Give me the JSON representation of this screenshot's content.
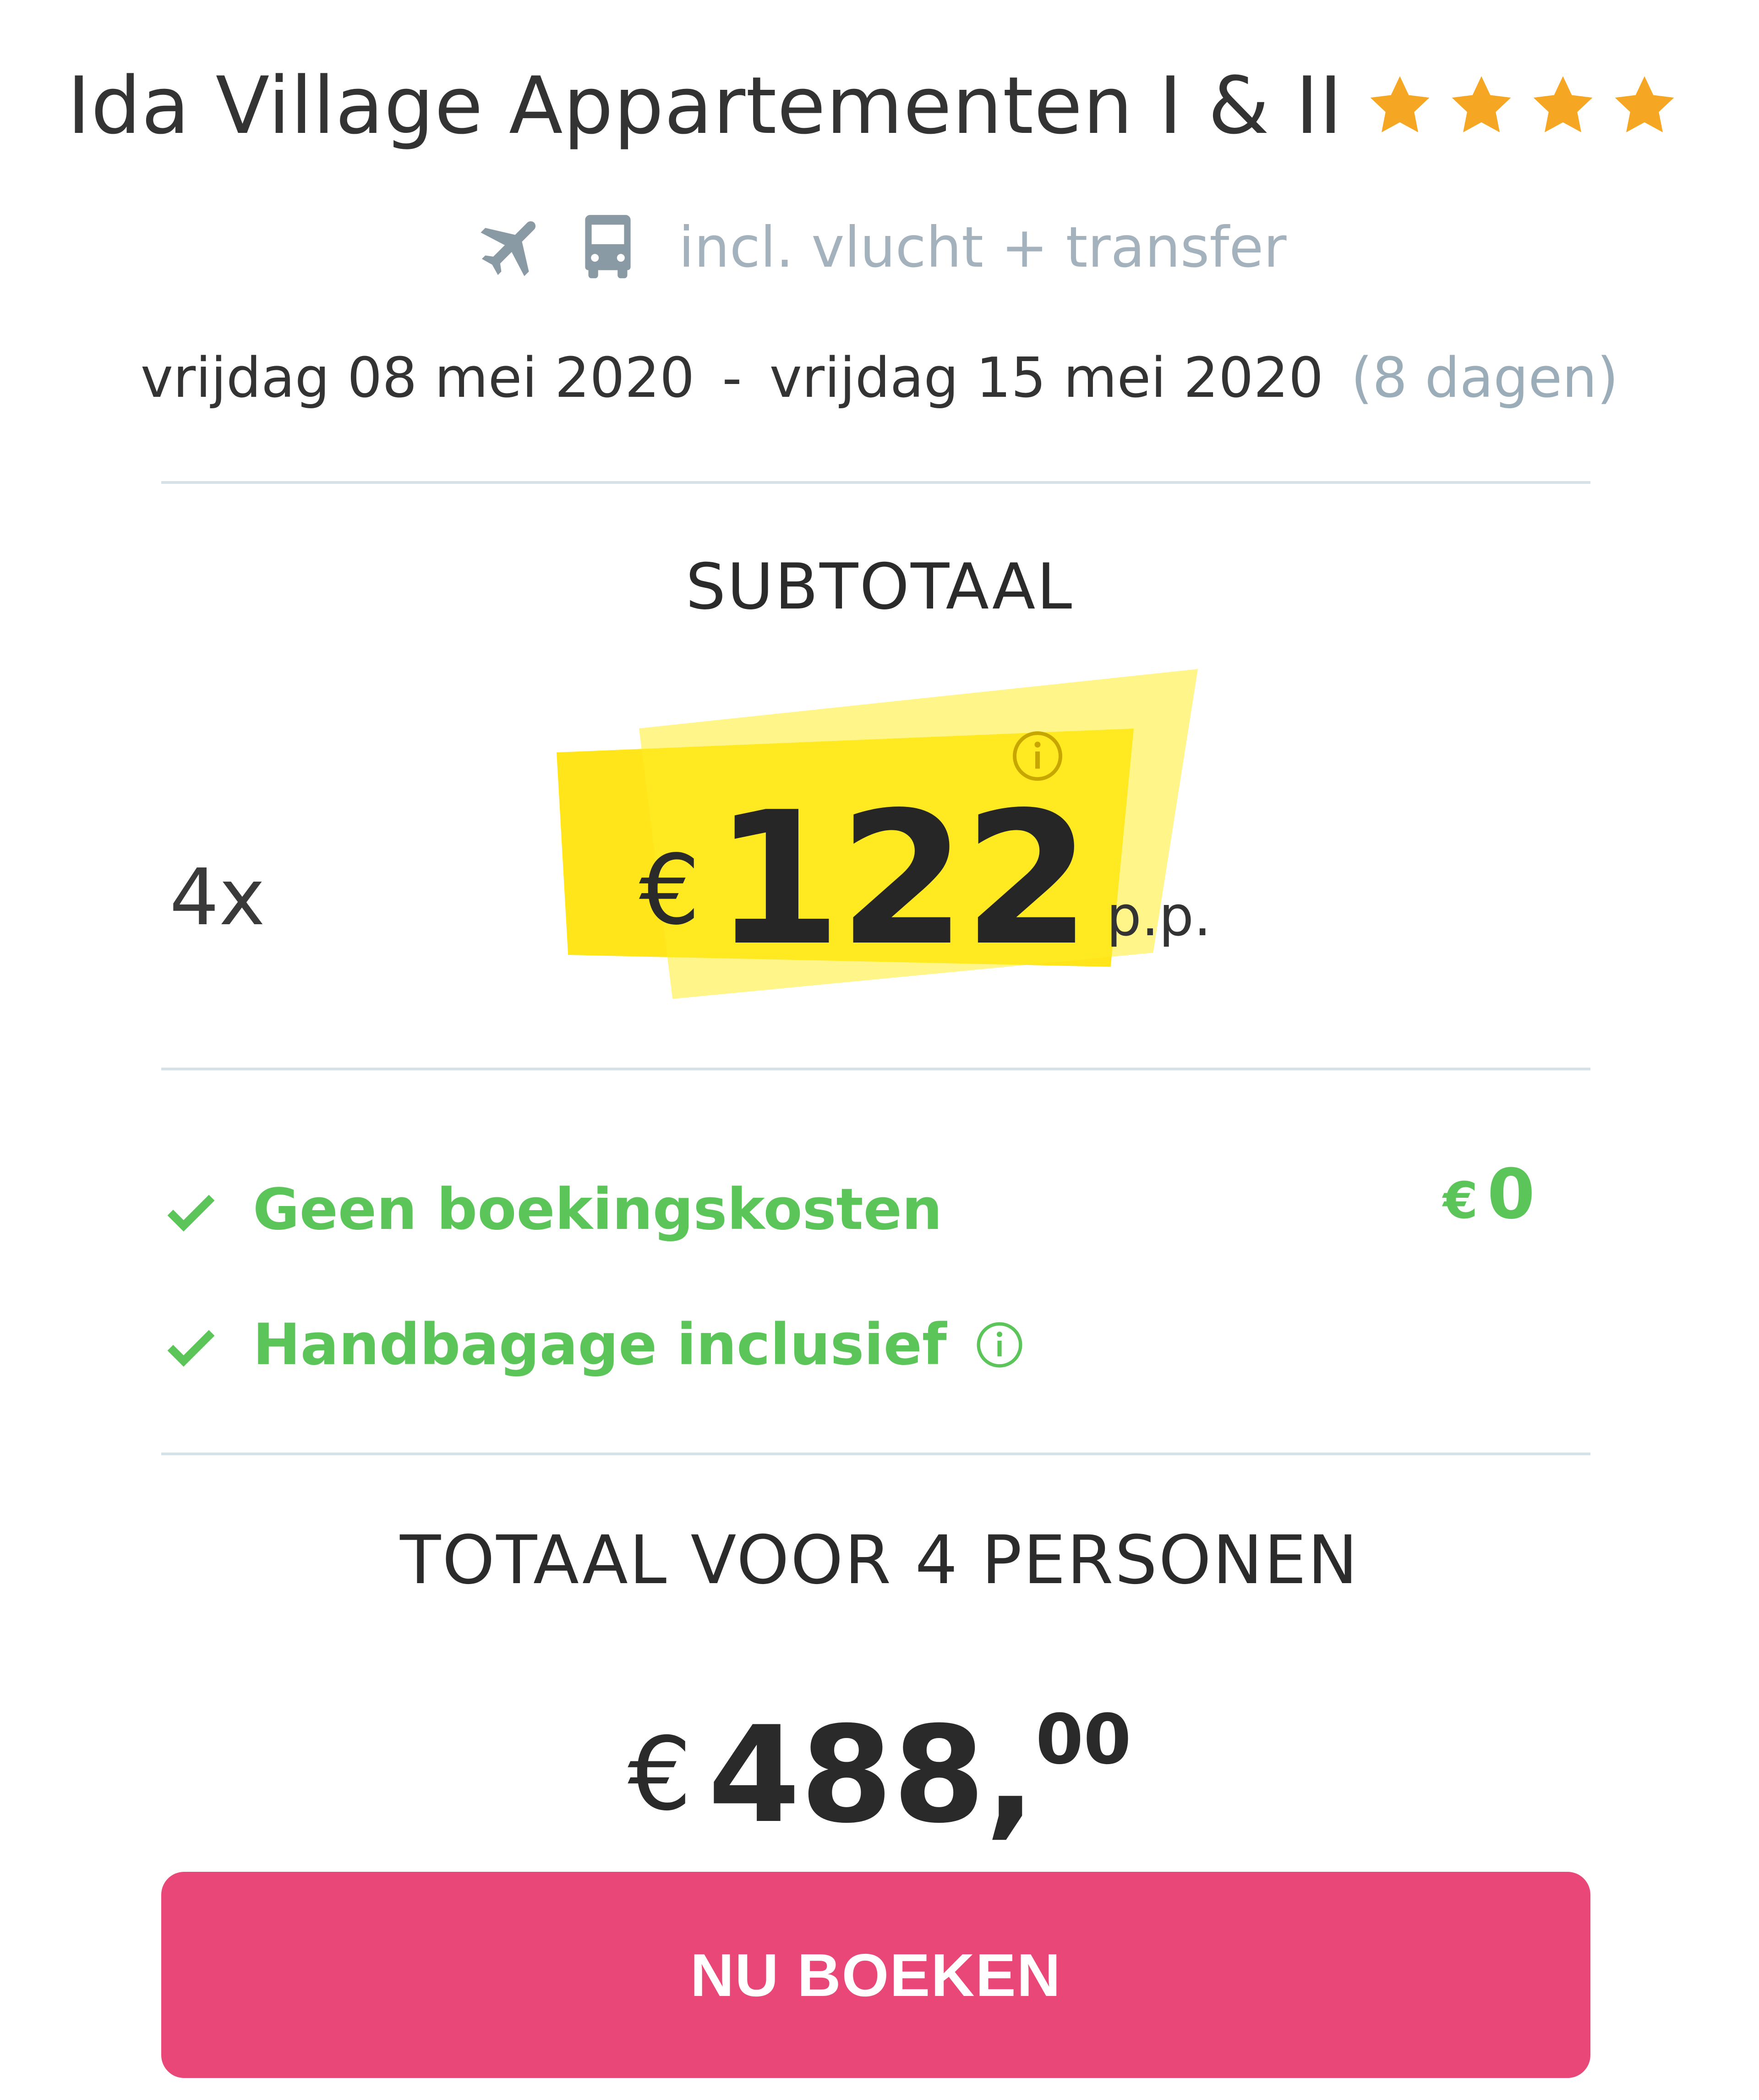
{
  "header": {
    "hotel_name": "Ida Village Appartementen I & II",
    "star_count": 4,
    "star_color": "#f5a623",
    "transport_icons": [
      "airplane-icon",
      "bus-icon"
    ],
    "transport_text": "incl. vlucht + transfer"
  },
  "dates": {
    "start": "vrijdag 08 mei 2020",
    "separator": "-",
    "end": "vrijdag 15 mei 2020",
    "duration": "(8 dagen)"
  },
  "subtotal": {
    "label": "SUBTOTAAL",
    "persons": "4x",
    "currency": "€",
    "price": "122",
    "per_person": "p.p.",
    "highlight_color": "#ffe51a"
  },
  "features": [
    {
      "label": "Geen boekingskosten",
      "value_currency": "€",
      "value": "0",
      "icon": "check-icon"
    },
    {
      "label": "Handbagage inclusief",
      "icon": "check-icon",
      "info": true
    }
  ],
  "feature_color": "#5cc55a",
  "total": {
    "label": "TOTAAL VOOR 4 PERSONEN",
    "currency": "€",
    "integer": "488",
    "comma": ",",
    "cents": "00"
  },
  "book_button": {
    "label": "NU BOEKEN",
    "color": "#e94777"
  }
}
